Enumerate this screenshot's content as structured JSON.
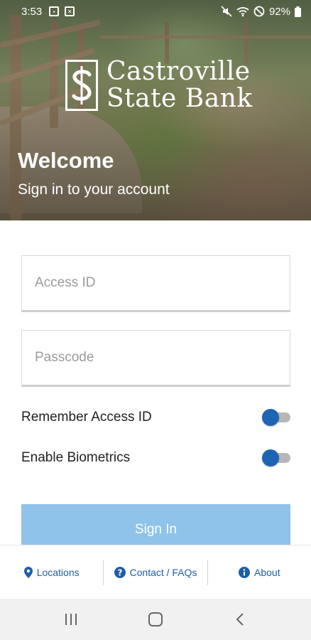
{
  "status_bar": {
    "time": "3:53",
    "battery": "92%",
    "icons": [
      "photo-notification-icon",
      "x-notification-icon",
      "mute-icon",
      "wifi-icon",
      "do-not-disturb-icon",
      "battery-icon"
    ]
  },
  "brand": {
    "name_line1": "Castroville",
    "name_line2": "State Bank",
    "logo_icon": "dollar-emblem-icon"
  },
  "header": {
    "title": "Welcome",
    "subtitle": "Sign in to your account"
  },
  "form": {
    "access_id_placeholder": "Access ID",
    "access_id_value": "",
    "passcode_placeholder": "Passcode",
    "passcode_value": "",
    "remember_label": "Remember Access ID",
    "biometrics_label": "Enable Biometrics",
    "signin_label": "Sign In"
  },
  "footer": {
    "items": [
      {
        "label": "Locations",
        "icon": "map-pin-icon"
      },
      {
        "label": "Contact / FAQs",
        "icon": "question-icon"
      },
      {
        "label": "About",
        "icon": "info-icon"
      }
    ]
  },
  "nav_bar": {
    "buttons": [
      "recent-apps-icon",
      "home-icon",
      "back-icon"
    ]
  },
  "colors": {
    "accent": "#1e64b4",
    "link": "#1d5fa6",
    "button_disabled": "#8fc3ea"
  }
}
